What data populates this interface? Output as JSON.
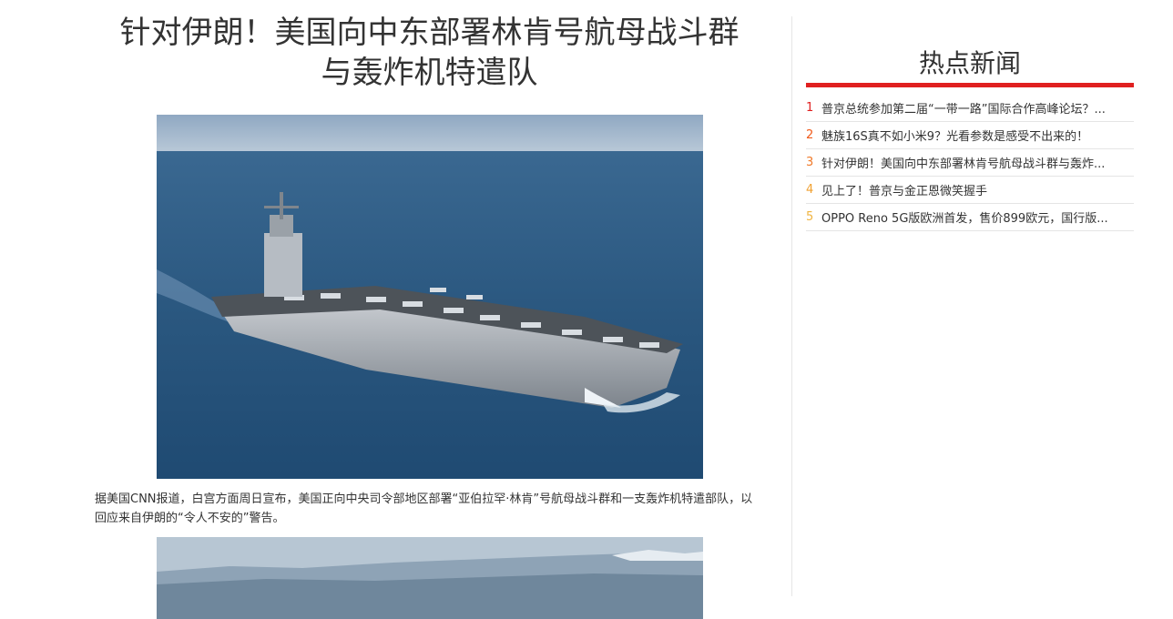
{
  "article": {
    "title_line1": "针对伊朗！美国向中东部署林肯号航母战斗群",
    "title_line2": "与轰炸机特遣队",
    "caption": "据美国CNN报道，白宫方面周日宣布，美国正向中央司令部地区部署“亚伯拉罕·林肯”号航母战斗群和一支轰炸机特遣部队，以回应来自伊朗的“令人不安的”警告。"
  },
  "sidebar": {
    "title": "热点新闻",
    "items": [
      {
        "rank": "1",
        "text": "普京总统参加第二届“一带一路”国际合作高峰论坛？..."
      },
      {
        "rank": "2",
        "text": "魅族16S真不如小米9？光看参数是感受不出来的！"
      },
      {
        "rank": "3",
        "text": "针对伊朗！美国向中东部署林肯号航母战斗群与轰炸..."
      },
      {
        "rank": "4",
        "text": "见上了！普京与金正恩微笑握手"
      },
      {
        "rank": "5",
        "text": "OPPO Reno 5G版欧洲首发，售价899欧元，国行版..."
      }
    ],
    "accent_color": "#e02020"
  },
  "colors": {
    "sea": "#2d5a86",
    "sky": "#a9bfd3"
  }
}
